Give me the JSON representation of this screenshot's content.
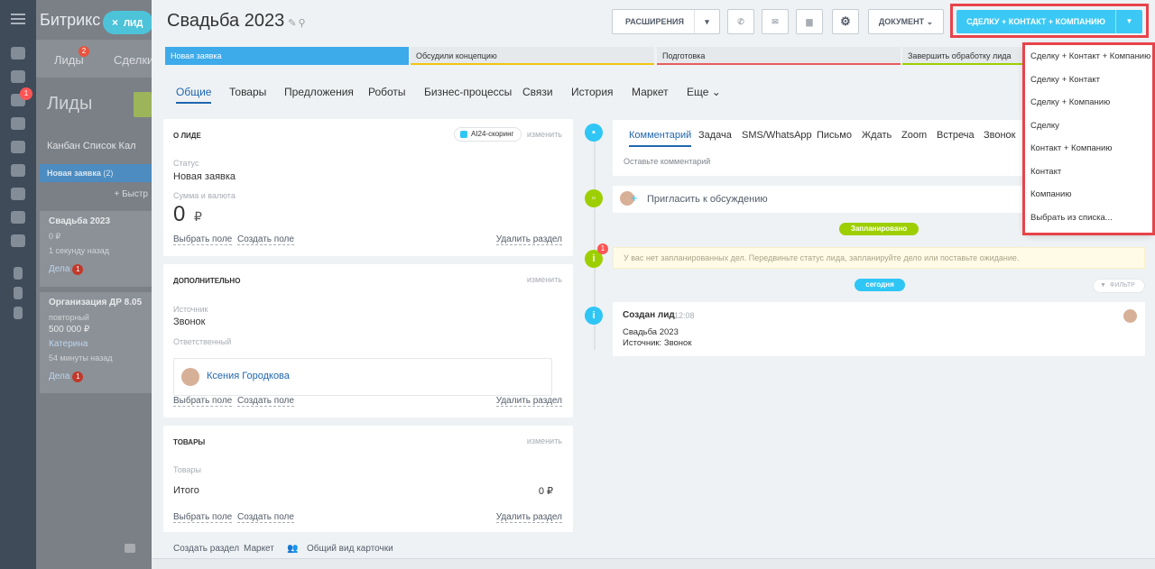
{
  "bg_app": {
    "title": "Битрикс",
    "tabs": [
      {
        "label": "Лиды",
        "badge": "2"
      },
      {
        "label": "Сделки",
        "badge": "1"
      }
    ],
    "page_title": "Лиды",
    "views": "Канбан   Список   Кал",
    "stage": "Новая заявка",
    "stage_count": "(2)",
    "fast_add": "+ Быстр",
    "cards": [
      {
        "title": "Свадьба 2023",
        "sum": "0 ₽",
        "time": "1 секунду назад",
        "deals": "Дела",
        "deals_count": "1"
      },
      {
        "title": "Организация ДР 8.05",
        "sub": "повторный",
        "sum": "500 000 ₽",
        "person": "Катерина",
        "time": "54 минуты назад",
        "deals": "Дела",
        "deals_count": "1"
      }
    ],
    "rail_badge": "1"
  },
  "close_chip": {
    "icon": "×",
    "label": "ЛИД"
  },
  "header": {
    "title": "Свадьба 2023",
    "extensions": "РАСШИРЕНИЯ",
    "document": "ДОКУМЕНТ",
    "convert": "СДЕЛКУ + КОНТАКТ + КОМПАНИЮ"
  },
  "stages": [
    "Новая заявка",
    "Обсудили концепцию",
    "Подготовка",
    "Завершить обработку лида"
  ],
  "tabs": [
    "Общие",
    "Товары",
    "Предложения",
    "Роботы",
    "Бизнес-процессы",
    "Связи",
    "История",
    "Маркет",
    "Еще"
  ],
  "about": {
    "header": "О ЛИДЕ",
    "scoring": "AI24-скоринг",
    "edit": "изменить",
    "status_label": "Статус",
    "status_value": "Новая заявка",
    "sum_label": "Сумма и валюта",
    "sum_value": "0",
    "currency": "₽"
  },
  "extra": {
    "header": "ДОПОЛНИТЕЛЬНО",
    "edit": "изменить",
    "source_label": "Источник",
    "source_value": "Звонок",
    "resp_label": "Ответственный",
    "resp_name": "Ксения Городкова"
  },
  "goods": {
    "header": "ТОВАРЫ",
    "edit": "изменить",
    "goods_label": "Товары",
    "total_label": "Итого",
    "total_value": "0 ₽"
  },
  "links": {
    "choose": "Выбрать поле",
    "create": "Создать поле",
    "delete": "Удалить раздел"
  },
  "bottom": {
    "create_section": "Создать раздел",
    "market": "Маркет",
    "common_view": "Общий вид карточки"
  },
  "editor": {
    "tabs": [
      "Комментарий",
      "Задача",
      "SMS/WhatsApp",
      "Письмо",
      "Ждать",
      "Zoom",
      "Встреча",
      "Звонок"
    ],
    "placeholder": "Оставьте комментарий"
  },
  "invite": "Пригласить к обсуждению",
  "planned": "Запланировано",
  "no_deals": "У вас нет запланированных дел. Передвиньте статус лида, запланируйте дело или поставьте ожидание.",
  "today": "сегодня",
  "filter": "ФИЛЬТР",
  "timeline_badge": "1",
  "created": {
    "title": "Создан лид",
    "time": "12:08",
    "line1": "Свадьба 2023",
    "line2": "Источник: Звонок"
  },
  "convert_menu": [
    "Сделку + Контакт + Компанию",
    "Сделку + Контакт",
    "Сделку + Компанию",
    "Сделку",
    "Контакт + Компанию",
    "Контакт",
    "Компанию",
    "Выбрать из списка..."
  ],
  "colors": {
    "accent": "#3bc8f5",
    "highlight": "#e8434a",
    "link": "#2067b0",
    "green": "#9dcf00"
  }
}
